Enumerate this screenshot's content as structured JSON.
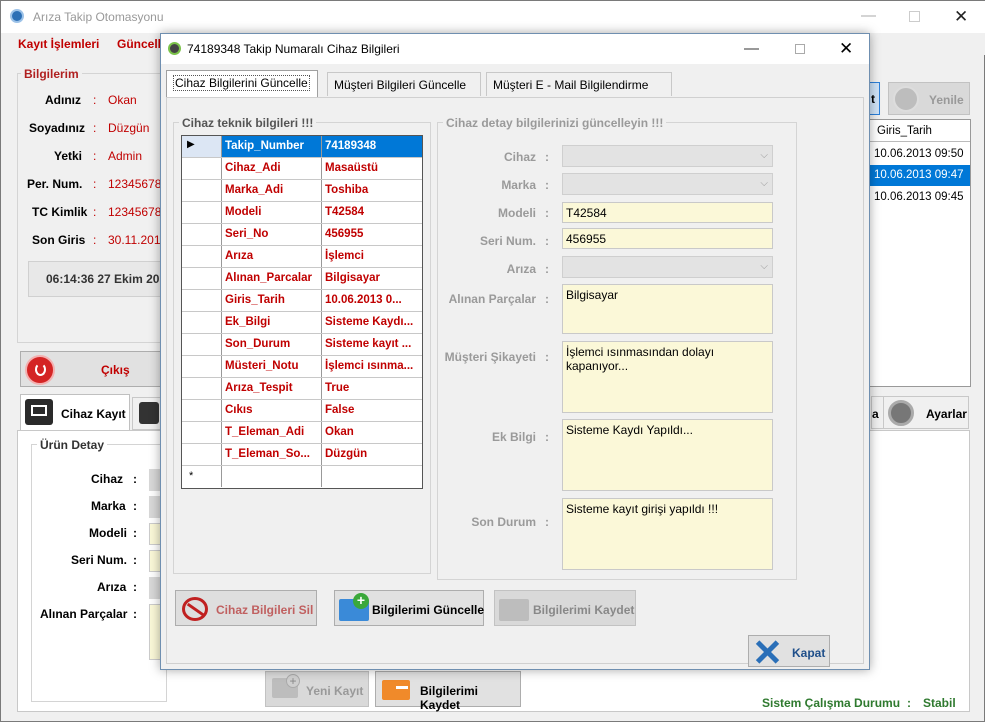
{
  "main": {
    "title": "Arıza Takip Otomasyonu",
    "menu": [
      "Kayıt İşlemleri",
      "Güncelle"
    ],
    "info_group": "Bilgilerim",
    "info": [
      {
        "label": "Adınız",
        "value": "Okan"
      },
      {
        "label": "Soyadınız",
        "value": "Düzgün"
      },
      {
        "label": "Yetki",
        "value": "Admin"
      },
      {
        "label": "Per. Num.",
        "value": "123456789"
      },
      {
        "label": "TC Kimlik",
        "value": "123456789"
      },
      {
        "label": "Son Giris",
        "value": "30.11.2015"
      }
    ],
    "clock": "06:14:36 27 Ekim 20",
    "exit_label": "Çıkış",
    "refresh_label": "Yenile",
    "top_right_btn": "t",
    "list_header": "Giris_Tarih",
    "list_rows": [
      "10.06.2013 09:50",
      "10.06.2013 09:47",
      "10.06.2013 09:45"
    ],
    "tabs": [
      "Cihaz Kayıt",
      "a",
      "Ayarlar"
    ],
    "product_group": "Ürün Detay",
    "product_fields": [
      "Cihaz",
      "Marka",
      "Modeli",
      "Seri Num.",
      "Arıza",
      "Alınan Parçalar"
    ],
    "new_record": "Yeni Kayıt",
    "save_info": "Bilgilerimi Kaydet",
    "status_label": "Sistem Çalışma Durumu",
    "status_colon": ":",
    "status_value": "Stabil"
  },
  "dialog": {
    "title": "74189348 Takip Numaralı Cihaz Bilgileri",
    "tabs": [
      "Cihaz Bilgilerini Güncelle",
      "Müşteri Bilgileri Güncelle",
      "Müşteri E - Mail Bilgilendirme"
    ],
    "grid_title": "Cihaz teknik bilgileri !!!",
    "grid_rows": [
      {
        "k": "Takip_Number",
        "v": "74189348"
      },
      {
        "k": "Cihaz_Adi",
        "v": "Masaüstü"
      },
      {
        "k": "Marka_Adi",
        "v": "Toshiba"
      },
      {
        "k": "Modeli",
        "v": "T42584"
      },
      {
        "k": "Seri_No",
        "v": "456955"
      },
      {
        "k": "Arıza",
        "v": "İşlemci"
      },
      {
        "k": "Alınan_Parcalar",
        "v": "Bilgisayar"
      },
      {
        "k": "Giris_Tarih",
        "v": "10.06.2013 0..."
      },
      {
        "k": "Ek_Bilgi",
        "v": "Sisteme Kaydı..."
      },
      {
        "k": "Son_Durum",
        "v": "Sisteme kayıt ..."
      },
      {
        "k": "Müsteri_Notu",
        "v": "İşlemci ısınma..."
      },
      {
        "k": "Arıza_Tespit",
        "v": "True"
      },
      {
        "k": "Cıkıs",
        "v": "False"
      },
      {
        "k": "T_Eleman_Adi",
        "v": "Okan"
      },
      {
        "k": "T_Eleman_So...",
        "v": "Düzgün"
      }
    ],
    "new_row_marker": "*",
    "detail_title": "Cihaz detay bilgilerinizi güncelleyin !!!",
    "labels": {
      "cihaz": "Cihaz",
      "marka": "Marka",
      "modeli": "Modeli",
      "seri": "Seri Num.",
      "ariza": "Arıza",
      "parcalar": "Alınan Parçalar",
      "sikayet": "Müşteri Şikayeti",
      "ek": "Ek Bilgi",
      "son": "Son Durum"
    },
    "values": {
      "modeli": "T42584",
      "seri": "456955",
      "parcalar": "Bilgisayar",
      "sikayet": "İşlemci ısınmasından dolayı kapanıyor...",
      "ek": "Sisteme Kaydı Yapıldı...",
      "son": "Sisteme kayıt girişi yapıldı !!!"
    },
    "btn_delete": "Cihaz Bilgileri Sil",
    "btn_update": "Bilgilerimi Güncelle",
    "btn_save": "Bilgilerimi Kaydet",
    "btn_close": "Kapat"
  }
}
